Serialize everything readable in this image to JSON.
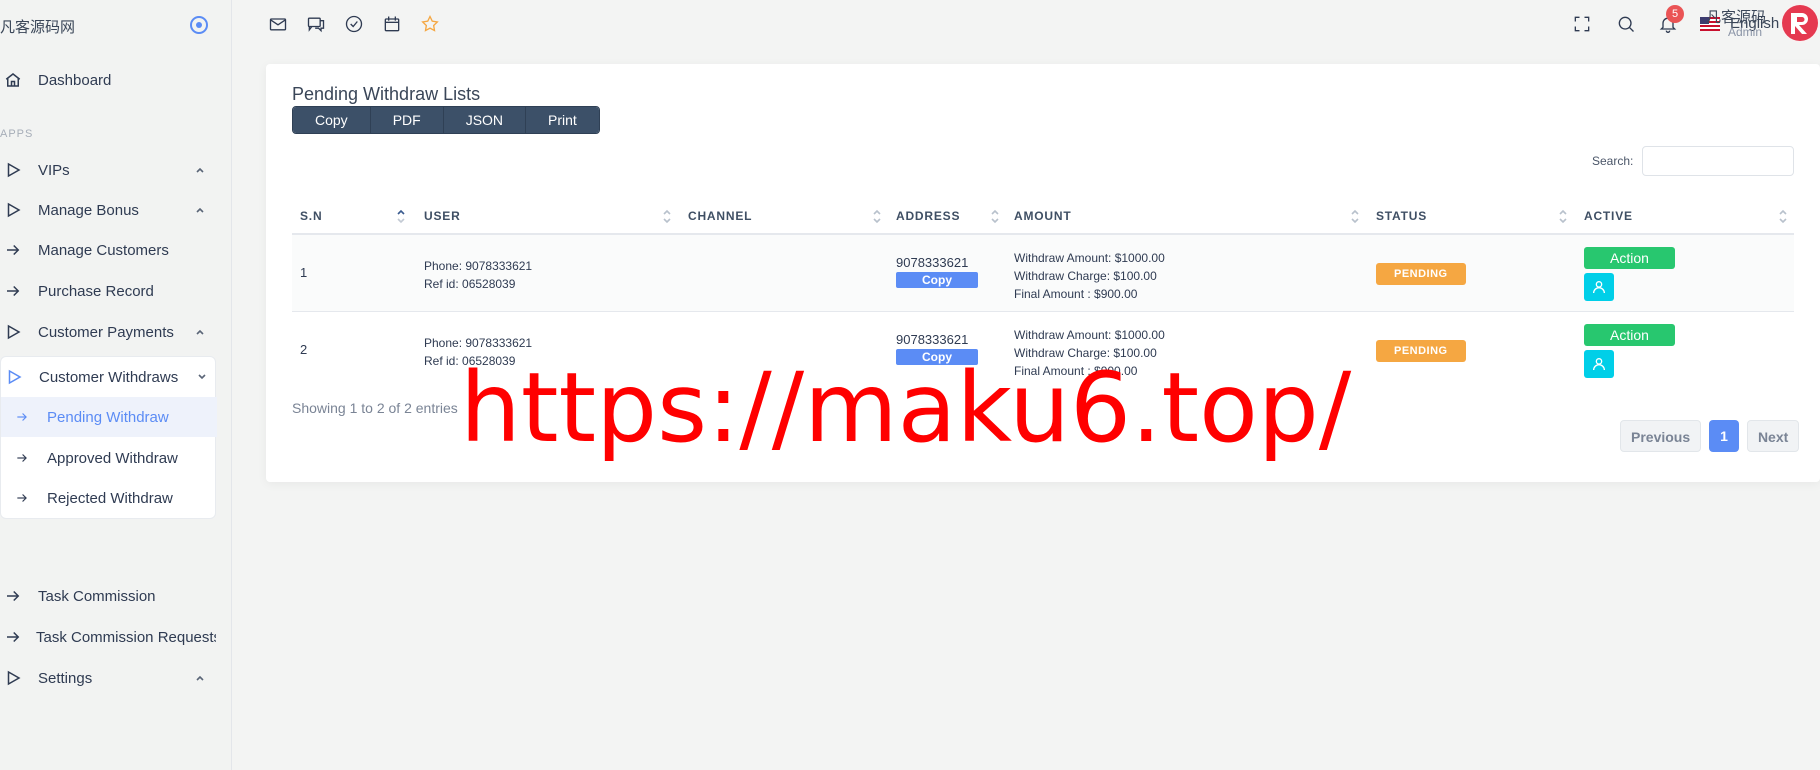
{
  "sidebar": {
    "brand": "凡客源码网",
    "menu_title": "APPS",
    "items": [
      {
        "label": "Dashboard"
      },
      {
        "label": "VIPs"
      },
      {
        "label": "Manage Bonus"
      },
      {
        "label": "Manage Customers"
      },
      {
        "label": "Purchase Record"
      },
      {
        "label": "Customer Payments"
      },
      {
        "label": "Customer Withdraws"
      },
      {
        "label": "Task Commission"
      },
      {
        "label": "Task Commission Requests"
      },
      {
        "label": "Settings"
      }
    ],
    "submenu": [
      {
        "label": "Pending Withdraw"
      },
      {
        "label": "Approved Withdraw"
      },
      {
        "label": "Rejected Withdraw"
      }
    ]
  },
  "topbar": {
    "language": "English",
    "notification_count": "5",
    "user_name": "凡客源码",
    "user_role": "Admin"
  },
  "card": {
    "title": "Pending Withdraw Lists",
    "buttons": [
      "Copy",
      "PDF",
      "JSON",
      "Print"
    ],
    "search_label": "Search:"
  },
  "table": {
    "headers": [
      "S.N",
      "USER",
      "CHANNEL",
      "ADDRESS",
      "AMOUNT",
      "STATUS",
      "ACTIVE"
    ],
    "rows": [
      {
        "sn": "1",
        "phone": "Phone: 9078333621",
        "ref": "Ref id: 06528039",
        "address": "9078333621",
        "copy": "Copy",
        "withdraw_amount": "Withdraw Amount: $1000.00",
        "withdraw_charge": "Withdraw Charge: $100.00",
        "final_amount": "Final Amount : $900.00",
        "status": "PENDING",
        "action": "Action"
      },
      {
        "sn": "2",
        "phone": "Phone: 9078333621",
        "ref": "Ref id: 06528039",
        "address": "9078333621",
        "copy": "Copy",
        "withdraw_amount": "Withdraw Amount: $1000.00",
        "withdraw_charge": "Withdraw Charge: $100.00",
        "final_amount": "Final Amount : $900.00",
        "status": "PENDING",
        "action": "Action"
      }
    ]
  },
  "footer": {
    "showing": "Showing 1 to 2 of 2 entries",
    "previous": "Previous",
    "page": "1",
    "next": "Next"
  },
  "watermark": "https://maku6.top/"
}
